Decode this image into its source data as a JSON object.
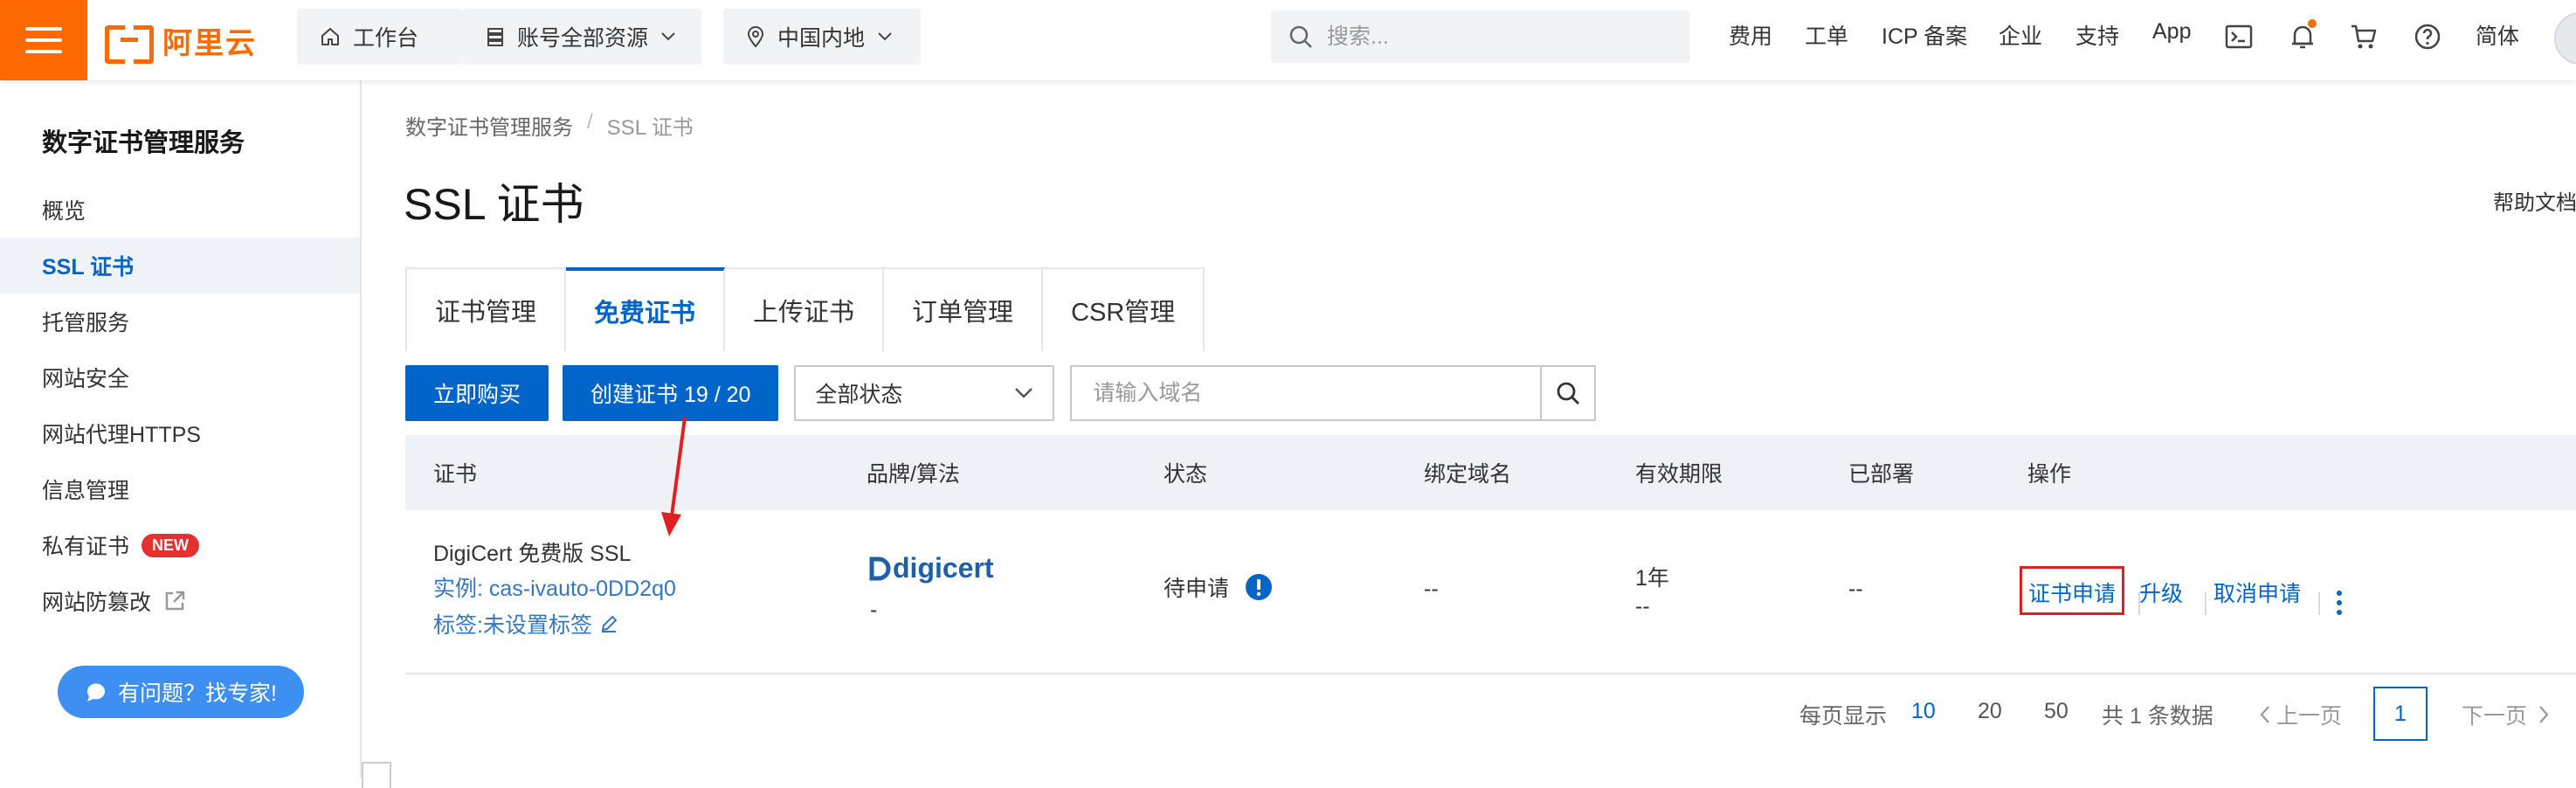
{
  "topbar": {
    "logo_text": "阿里云",
    "workbench": "工作台",
    "resources": "账号全部资源",
    "region": "中国内地",
    "search_placeholder": "搜索...",
    "links": [
      "费用",
      "工单",
      "ICP 备案",
      "企业",
      "支持",
      "App"
    ],
    "lang": "简体"
  },
  "sidebar": {
    "title": "数字证书管理服务",
    "items": [
      {
        "label": "概览",
        "active": false
      },
      {
        "label": "SSL 证书",
        "active": true
      },
      {
        "label": "托管服务",
        "active": false
      },
      {
        "label": "网站安全",
        "active": false
      },
      {
        "label": "网站代理HTTPS",
        "active": false
      },
      {
        "label": "信息管理",
        "active": false
      },
      {
        "label": "私有证书",
        "active": false,
        "badge": "NEW"
      },
      {
        "label": "网站防篡改",
        "active": false
      }
    ],
    "help_button": "有问题？找专家!"
  },
  "breadcrumb": [
    "数字证书管理服务",
    "SSL 证书"
  ],
  "page_title": "SSL 证书",
  "help_doc": "帮助文档",
  "tabs": [
    "证书管理",
    "免费证书",
    "上传证书",
    "订单管理",
    "CSR管理"
  ],
  "active_tab": "免费证书",
  "toolbar": {
    "buy": "立即购买",
    "create": "创建证书 19 / 20",
    "status_select": "全部状态",
    "domain_placeholder": "请输入域名"
  },
  "table": {
    "columns": [
      "证书",
      "品牌/算法",
      "状态",
      "绑定域名",
      "有效期限",
      "已部署",
      "操作"
    ],
    "row": {
      "cert_name": "DigiCert 免费版 SSL",
      "instance": "实例: cas-ivauto-0DD2q0",
      "tags": "标签:未设置标签",
      "brand": "digicert",
      "algorithm": "-",
      "status": "待申请",
      "domain": "--",
      "validity_1": "1年",
      "validity_2": "--",
      "deployed": "--",
      "actions": [
        "证书申请",
        "升级",
        "取消申请"
      ]
    }
  },
  "pagination": {
    "per_page_label": "每页显示",
    "sizes": [
      "10",
      "20",
      "50"
    ],
    "total": "共 1 条数据",
    "prev": "上一页",
    "current": "1",
    "next": "下一页"
  },
  "colors": {
    "brand_orange": "#ff6a00",
    "primary_blue": "#0064c8",
    "highlight_red": "#e02020"
  }
}
